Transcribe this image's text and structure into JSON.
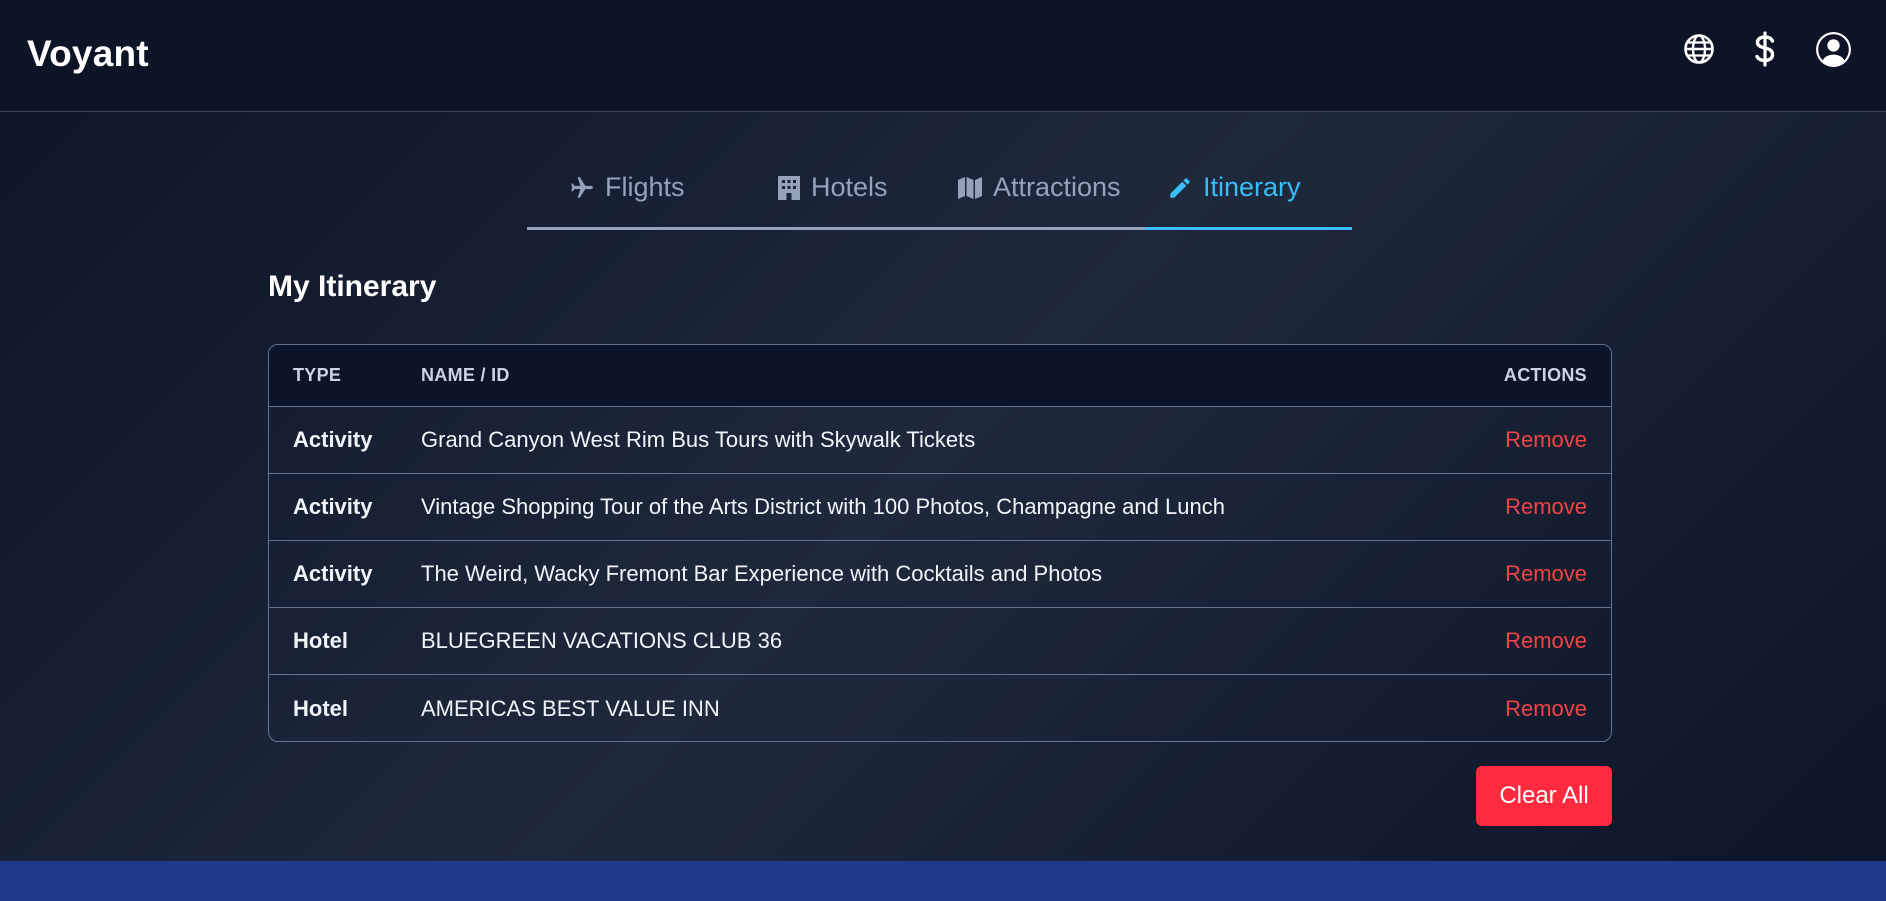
{
  "app": {
    "brand": "Voyant"
  },
  "header": {
    "icons": [
      "globe-icon",
      "dollar-icon",
      "user-circle-icon"
    ]
  },
  "tabs": [
    {
      "label": "Flights",
      "icon": "plane-icon",
      "active": false
    },
    {
      "label": "Hotels",
      "icon": "building-icon",
      "active": false
    },
    {
      "label": "Attractions",
      "icon": "map-icon",
      "active": false
    },
    {
      "label": "Itinerary",
      "icon": "pencil-icon",
      "active": true
    }
  ],
  "itinerary": {
    "title": "My Itinerary",
    "columns": {
      "type": "TYPE",
      "name": "NAME / ID",
      "actions": "ACTIONS"
    },
    "rows": [
      {
        "type": "Activity",
        "name": "Grand Canyon West Rim Bus Tours with Skywalk Tickets",
        "action": "Remove"
      },
      {
        "type": "Activity",
        "name": "Vintage Shopping Tour of the Arts District with 100 Photos, Champagne and Lunch",
        "action": "Remove"
      },
      {
        "type": "Activity",
        "name": "The Weird, Wacky Fremont Bar Experience with Cocktails and Photos",
        "action": "Remove"
      },
      {
        "type": "Hotel",
        "name": "BLUEGREEN VACATIONS CLUB 36",
        "action": "Remove"
      },
      {
        "type": "Hotel",
        "name": "AMERICAS BEST VALUE INN",
        "action": "Remove"
      }
    ],
    "clear_label": "Clear All"
  },
  "colors": {
    "accent": "#38bdf8",
    "danger": "#ef4444",
    "clear_button": "#ff2a3d",
    "footer": "#1e3a8a"
  }
}
